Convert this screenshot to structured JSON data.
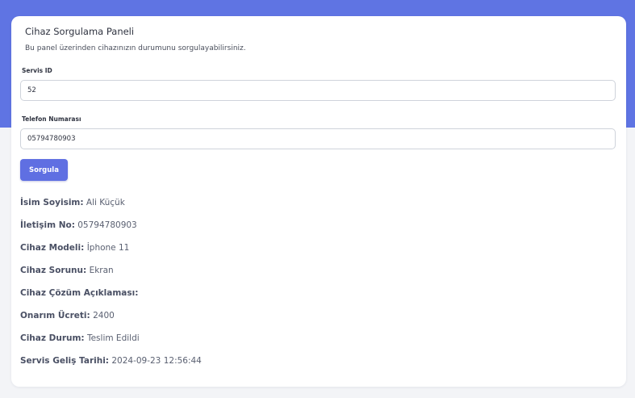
{
  "panel": {
    "title": "Cihaz Sorgulama Paneli",
    "subtitle": "Bu panel üzerinden cihazınızın durumunu sorgulayabilirsiniz."
  },
  "form": {
    "servis_id_label": "Servis ID",
    "servis_id_value": "52",
    "telefon_label": "Telefon Numarası",
    "telefon_value": "05794780903",
    "submit_label": "Sorgula"
  },
  "result": [
    {
      "label": "İsim Soyisim:",
      "value": "Ali Küçük"
    },
    {
      "label": "İletişim No:",
      "value": "05794780903"
    },
    {
      "label": "Cihaz Modeli:",
      "value": "İphone 11"
    },
    {
      "label": "Cihaz Sorunu:",
      "value": "Ekran"
    },
    {
      "label": "Cihaz Çözüm Açıklaması:",
      "value": ""
    },
    {
      "label": "Onarım Ücreti:",
      "value": "2400"
    },
    {
      "label": "Cihaz Durum:",
      "value": "Teslim Edildi"
    },
    {
      "label": "Servis Geliş Tarihi:",
      "value": "2024-09-23 12:56:44"
    }
  ],
  "colors": {
    "header_band": "#5f74e3",
    "button": "#5f6fe2",
    "page_background": "#f3f4f7"
  }
}
